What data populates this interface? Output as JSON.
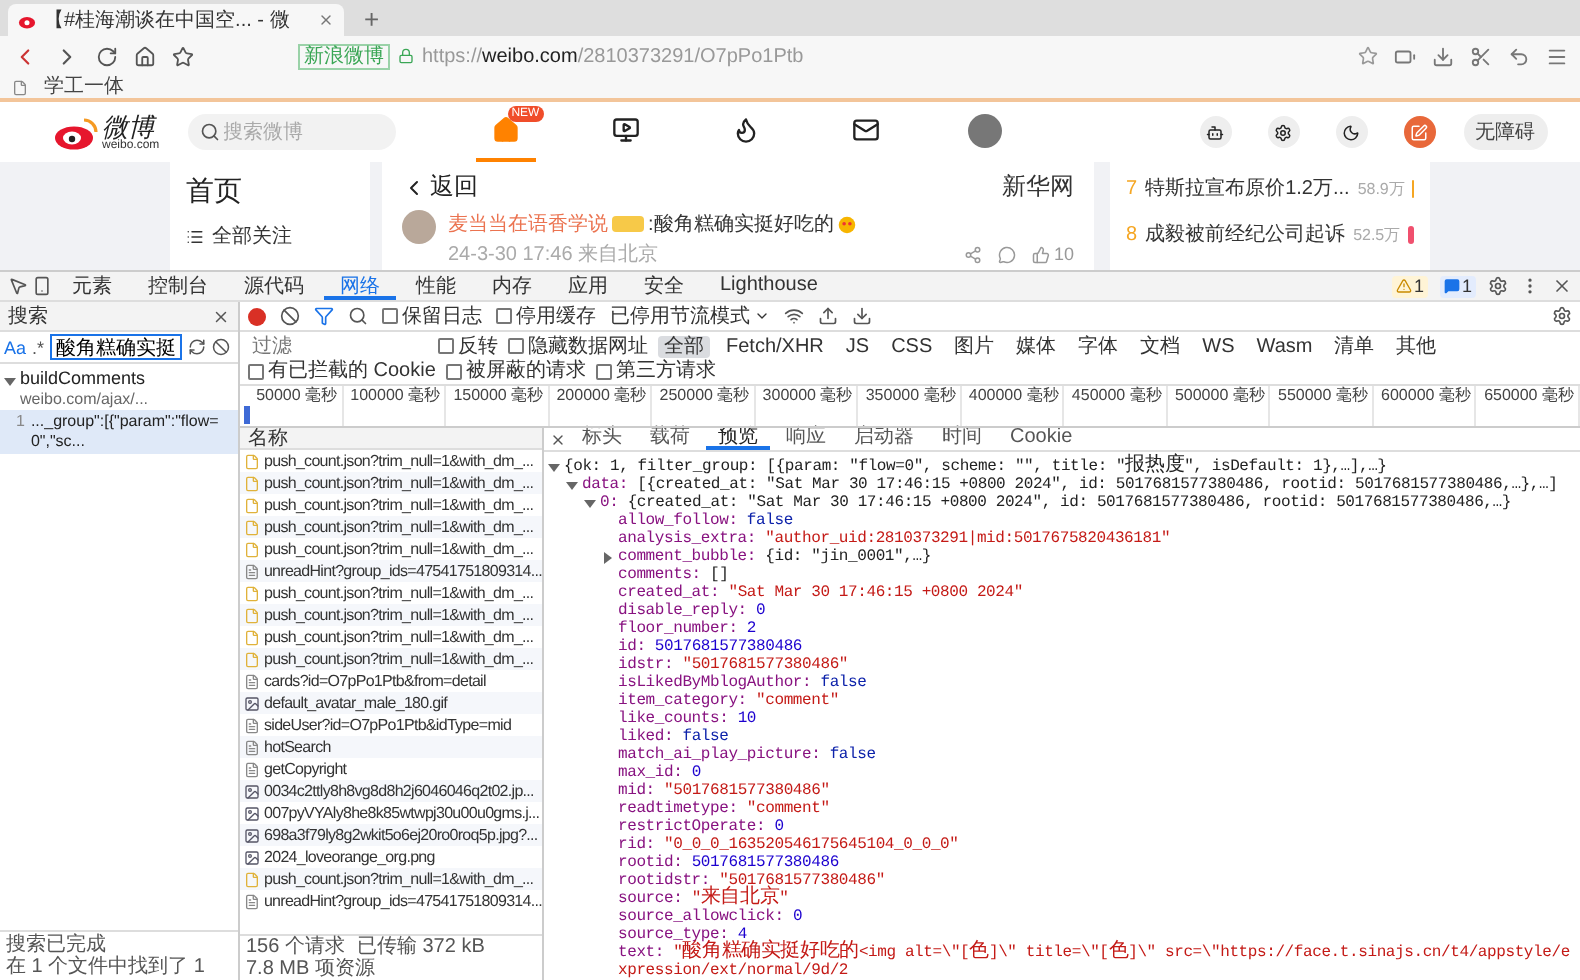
{
  "browser": {
    "tab": {
      "title": "【#桂海潮谈在中国空... - 微"
    },
    "new_tab": "+",
    "site_badge": "新浪微博",
    "url": "https://**weibo.com**/2810373291/O7pPo1Ptb",
    "bookmarks": [
      "学工一体"
    ]
  },
  "weibo": {
    "logo": {
      "name": "微博",
      "domain": "weibo.com"
    },
    "search": {
      "placeholder": "搜索微博"
    },
    "nav": [
      {
        "kind": "home",
        "selected": true,
        "badge": "NEW"
      },
      {
        "kind": "video",
        "selected": false
      },
      {
        "kind": "hot",
        "selected": false
      },
      {
        "kind": "mail",
        "selected": false
      },
      {
        "kind": "avatar",
        "selected": false
      }
    ],
    "tools": [
      {
        "kind": "bot"
      },
      {
        "kind": "settings"
      },
      {
        "kind": "theme"
      },
      {
        "kind": "compose"
      }
    ],
    "accessibility_button": "无障碍",
    "sidebar": {
      "title": "首页",
      "items": [
        {
          "label": "全部关注"
        }
      ]
    },
    "post": {
      "back": "返回",
      "title": "新华网",
      "comment": {
        "user": "麦当当在语香学说",
        "text": ":酸角糕确实挺好吃的",
        "meta": "24-3-30 17:46 来自北京",
        "likes": "10"
      }
    },
    "hot_list": [
      {
        "rank": "7",
        "title": "特斯拉宣布原价1.2万...",
        "count": "58.9万",
        "color": "#f5a623"
      },
      {
        "rank": "8",
        "title": "成毅被前经纪公司起诉",
        "count": "52.5万",
        "color": "#f0506e"
      }
    ]
  },
  "devtools": {
    "tabs": [
      {
        "label": "元素",
        "selected": false
      },
      {
        "label": "控制台",
        "selected": false
      },
      {
        "label": "源代码",
        "selected": false
      },
      {
        "label": "网络",
        "selected": true
      },
      {
        "label": "性能",
        "selected": false
      },
      {
        "label": "内存",
        "selected": false
      },
      {
        "label": "应用",
        "selected": false
      },
      {
        "label": "安全",
        "selected": false
      },
      {
        "label": "Lighthouse",
        "selected": false
      }
    ],
    "warnings": "1",
    "messages": "1",
    "search_panel": {
      "title": "搜索",
      "case_toggle": "Aa",
      "regex_toggle": ".*",
      "query": "酸角糕确实挺",
      "results": [
        {
          "file": "buildComments",
          "origin": "weibo.com/ajax/...",
          "expanded": true,
          "matches": [
            {
              "line": "1",
              "text": "..._group\":[{\"param\":\"flow=0\",\"sc..."
            }
          ]
        }
      ],
      "status": [
        "搜索已完成",
        "在 1 个文件中找到了 1"
      ]
    },
    "network": {
      "recording": true,
      "preserve_log": {
        "label": "保留日志",
        "checked": false
      },
      "disable_cache": {
        "label": "停用缓存",
        "checked": false
      },
      "throttling": "已停用节流模式",
      "filter": {
        "placeholder": "过滤",
        "invert": {
          "label": "反转",
          "checked": false
        },
        "hide_data_urls": {
          "label": "隐藏数据网址",
          "checked": false
        },
        "types": [
          {
            "label": "全部",
            "selected": true
          },
          {
            "label": "Fetch/XHR",
            "selected": false
          },
          {
            "label": "JS",
            "selected": false
          },
          {
            "label": "CSS",
            "selected": false
          },
          {
            "label": "图片",
            "selected": false
          },
          {
            "label": "媒体",
            "selected": false
          },
          {
            "label": "字体",
            "selected": false
          },
          {
            "label": "文档",
            "selected": false
          },
          {
            "label": "WS",
            "selected": false
          },
          {
            "label": "Wasm",
            "selected": false
          },
          {
            "label": "清单",
            "selected": false
          },
          {
            "label": "其他",
            "selected": false
          }
        ],
        "extra": [
          {
            "label": "有已拦截的 Cookie",
            "checked": false
          },
          {
            "label": "被屏蔽的请求",
            "checked": false
          },
          {
            "label": "第三方请求",
            "checked": false
          }
        ]
      },
      "timeline": [
        "50000 毫秒",
        "100000 毫秒",
        "150000 毫秒",
        "200000 毫秒",
        "250000 毫秒",
        "300000 毫秒",
        "350000 毫秒",
        "400000 毫秒",
        "450000 毫秒",
        "500000 毫秒",
        "550000 毫秒",
        "600000 毫秒",
        "650000 毫秒"
      ],
      "requests": {
        "header": "名称",
        "rows": [
          {
            "name": "push_count.json?trim_null=1&with_dm_...",
            "kind": "json"
          },
          {
            "name": "push_count.json?trim_null=1&with_dm_...",
            "kind": "json"
          },
          {
            "name": "push_count.json?trim_null=1&with_dm_...",
            "kind": "json"
          },
          {
            "name": "push_count.json?trim_null=1&with_dm_...",
            "kind": "json"
          },
          {
            "name": "push_count.json?trim_null=1&with_dm_...",
            "kind": "json"
          },
          {
            "name": "unreadHint?group_ids=47541751809314...",
            "kind": "doc"
          },
          {
            "name": "push_count.json?trim_null=1&with_dm_...",
            "kind": "json"
          },
          {
            "name": "push_count.json?trim_null=1&with_dm_...",
            "kind": "json"
          },
          {
            "name": "push_count.json?trim_null=1&with_dm_...",
            "kind": "json"
          },
          {
            "name": "push_count.json?trim_null=1&with_dm_...",
            "kind": "json"
          },
          {
            "name": "cards?id=O7pPo1Ptb&from=detail",
            "kind": "doc"
          },
          {
            "name": "default_avatar_male_180.gif",
            "kind": "image"
          },
          {
            "name": "sideUser?id=O7pPo1Ptb&idType=mid",
            "kind": "doc"
          },
          {
            "name": "hotSearch",
            "kind": "doc"
          },
          {
            "name": "getCopyright",
            "kind": "doc"
          },
          {
            "name": "0034c2ttly8h8vg8d8h2j6046046q2t02.jp...",
            "kind": "image"
          },
          {
            "name": "007pyVYAly8he8k85wtwpj30u00u0gms.j...",
            "kind": "image"
          },
          {
            "name": "698a3f79ly8g2wkit5o6ej20ro0roq5p.jpg?...",
            "kind": "image"
          },
          {
            "name": "2024_loveorange_org.png",
            "kind": "image"
          },
          {
            "name": "push_count.json?trim_null=1&with_dm_...",
            "kind": "json"
          },
          {
            "name": "unreadHint?group_ids=47541751809314...",
            "kind": "doc"
          }
        ]
      },
      "summary": [
        "156 个请求",
        "已传输 372 kB",
        "7.8 MB 项资源"
      ]
    },
    "preview": {
      "tabs": [
        {
          "label": "标头",
          "selected": false
        },
        {
          "label": "载荷",
          "selected": false
        },
        {
          "label": "预览",
          "selected": true
        },
        {
          "label": "响应",
          "selected": false
        },
        {
          "label": "启动器",
          "selected": false
        },
        {
          "label": "时间",
          "selected": false
        },
        {
          "label": "Cookie",
          "selected": false
        }
      ],
      "tree": [
        {
          "kind": "object",
          "value": "{ok: 1, filter_group: [{param: \"flow=0\", scheme: \"\", title: \"报热度\", isDefault: 1},…],…}",
          "expanded": true,
          "children": [
            {
              "kind": "object",
              "key": "data:",
              "value": "[{created_at: \"Sat Mar 30 17:46:15 +0800 2024\", id: 5017681577380486, rootid: 5017681577380486,…},…]",
              "expanded": true,
              "children": [
                {
                  "kind": "object",
                  "key": "0:",
                  "value": "{created_at: \"Sat Mar 30 17:46:15 +0800 2024\", id: 5017681577380486, rootid: 5017681577380486,…}",
                  "expanded": true,
                  "children": [
                    {
                      "kind": "bool",
                      "key": "allow_follow:",
                      "value": "false"
                    },
                    {
                      "kind": "string",
                      "key": "analysis_extra:",
                      "value": "\"author_uid:2810373291|mid:5017675820436181\""
                    },
                    {
                      "kind": "object",
                      "key": "comment_bubble:",
                      "value": "{id: \"jin_0001\",…}",
                      "expanded": false
                    },
                    {
                      "kind": "plain",
                      "key": "comments:",
                      "value": "[]"
                    },
                    {
                      "kind": "string",
                      "key": "created_at:",
                      "value": "\"Sat Mar 30 17:46:15 +0800 2024\""
                    },
                    {
                      "kind": "number",
                      "key": "disable_reply:",
                      "value": "0"
                    },
                    {
                      "kind": "number",
                      "key": "floor_number:",
                      "value": "2"
                    },
                    {
                      "kind": "number",
                      "key": "id:",
                      "value": "5017681577380486"
                    },
                    {
                      "kind": "string",
                      "key": "idstr:",
                      "value": "\"5017681577380486\""
                    },
                    {
                      "kind": "bool",
                      "key": "isLikedByMblogAuthor:",
                      "value": "false"
                    },
                    {
                      "kind": "string",
                      "key": "item_category:",
                      "value": "\"comment\""
                    },
                    {
                      "kind": "number",
                      "key": "like_counts:",
                      "value": "10"
                    },
                    {
                      "kind": "bool",
                      "key": "liked:",
                      "value": "false"
                    },
                    {
                      "kind": "bool",
                      "key": "match_ai_play_picture:",
                      "value": "false"
                    },
                    {
                      "kind": "number",
                      "key": "max_id:",
                      "value": "0"
                    },
                    {
                      "kind": "string",
                      "key": "mid:",
                      "value": "\"5017681577380486\""
                    },
                    {
                      "kind": "string",
                      "key": "readtimetype:",
                      "value": "\"comment\""
                    },
                    {
                      "kind": "number",
                      "key": "restrictOperate:",
                      "value": "0"
                    },
                    {
                      "kind": "string",
                      "key": "rid:",
                      "value": "\"0_0_0_163520546175645104_0_0_0\""
                    },
                    {
                      "kind": "number",
                      "key": "rootid:",
                      "value": "5017681577380486"
                    },
                    {
                      "kind": "string",
                      "key": "rootidstr:",
                      "value": "\"5017681577380486\""
                    },
                    {
                      "kind": "string",
                      "key": "source:",
                      "value": "\"来自北京\""
                    },
                    {
                      "kind": "number",
                      "key": "source_allowclick:",
                      "value": "0"
                    },
                    {
                      "kind": "number",
                      "key": "source_type:",
                      "value": "4"
                    },
                    {
                      "kind": "string",
                      "key": "text:",
                      "value": "\"酸角糕确实挺好吃的<img alt=\\\"[色]\\\" title=\\\"[色]\\\" src=\\\"https://face.t.sinajs.cn/t4/appstyle/expression/ext/normal/9d/2"
                    }
                  ]
                }
              ]
            }
          ]
        }
      ]
    }
  }
}
